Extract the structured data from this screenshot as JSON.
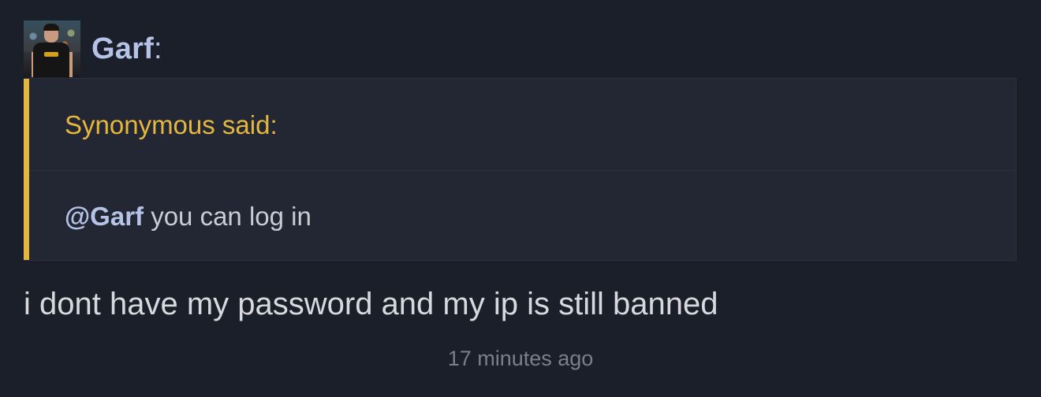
{
  "author": {
    "name": "Garf",
    "colon": ":"
  },
  "quote": {
    "attribution": "Synonymous said:",
    "mention": "@Garf",
    "text": " you can log in"
  },
  "message": "i dont have my password and my ip is still banned",
  "timestamp": "17 minutes ago",
  "colors": {
    "background": "#1b1f2a",
    "quote_background": "#232733",
    "accent": "#e5b73e",
    "username": "#b5c3e6"
  }
}
